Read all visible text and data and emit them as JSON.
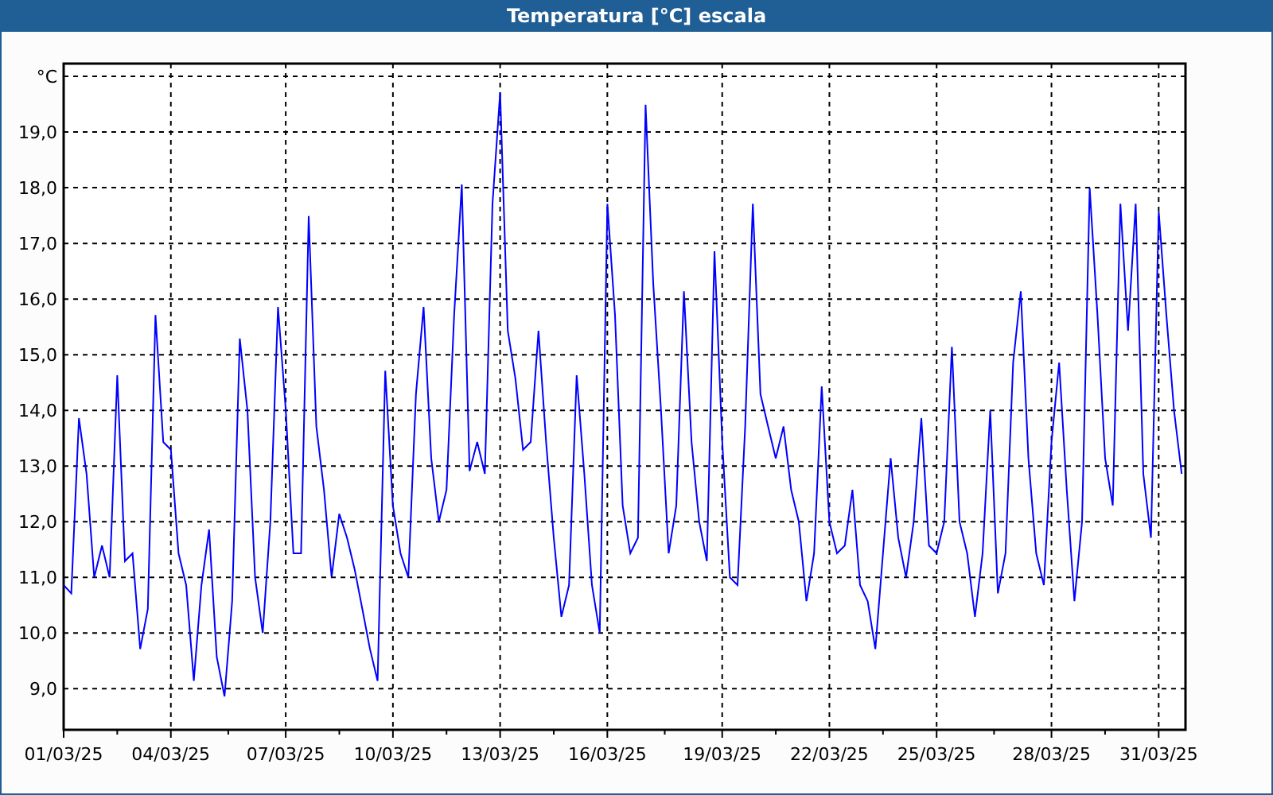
{
  "window": {
    "title": "Temperatura [°C] escala"
  },
  "chart": {
    "chart_data": {
      "type": "line",
      "categories": [
        "01/03/25",
        null,
        null,
        null,
        null,
        null,
        null,
        null,
        null,
        null,
        null,
        null,
        null,
        null,
        "04/03/25",
        null,
        null,
        null,
        null,
        null,
        null,
        null,
        null,
        null,
        null,
        null,
        null,
        null,
        null,
        "07/03/25",
        null,
        null,
        null,
        null,
        null,
        null,
        null,
        null,
        null,
        null,
        null,
        null,
        null,
        "10/03/25",
        null,
        null,
        null,
        null,
        null,
        null,
        null,
        null,
        null,
        null,
        null,
        null,
        null,
        "13/03/25",
        null,
        null,
        null,
        null,
        null,
        null,
        null,
        null,
        null,
        null,
        null,
        null,
        null,
        "16/03/25",
        null,
        null,
        null,
        null,
        null,
        null,
        null,
        null,
        null,
        null,
        null,
        null,
        null,
        null,
        "19/03/25",
        null,
        null,
        null,
        null,
        null,
        null,
        null,
        null,
        null,
        null,
        null,
        null,
        null,
        "22/03/25",
        null,
        null,
        null,
        null,
        null,
        null,
        null,
        null,
        null,
        null,
        null,
        null,
        null,
        "25/03/25",
        null,
        null,
        null,
        null,
        null,
        null,
        null,
        null,
        null,
        null,
        null,
        null,
        null,
        null,
        "28/03/25",
        null,
        null,
        null,
        null,
        null,
        null,
        null,
        null,
        null,
        null,
        null,
        null,
        null,
        "31/03/25",
        null,
        null,
        null
      ],
      "series": [
        {
          "color": "#0000ff",
          "values": [
            10.86,
            10.71,
            13.86,
            12.86,
            11.0,
            11.57,
            11.0,
            14.63,
            11.29,
            11.43,
            9.71,
            10.43,
            15.71,
            13.43,
            13.29,
            11.43,
            10.86,
            9.14,
            10.86,
            11.86,
            9.57,
            8.86,
            10.57,
            15.29,
            14.0,
            11.0,
            10.0,
            12.0,
            15.86,
            14.0,
            11.43,
            11.43,
            17.49,
            13.71,
            12.57,
            11.0,
            12.14,
            11.71,
            11.14,
            10.43,
            9.71,
            9.14,
            14.71,
            12.29,
            11.43,
            11.0,
            14.29,
            15.86,
            13.14,
            12.0,
            12.57,
            15.71,
            18.06,
            12.91,
            13.43,
            12.86,
            17.71,
            19.71,
            15.43,
            14.57,
            13.29,
            13.43,
            15.43,
            13.43,
            11.71,
            10.29,
            10.86,
            14.63,
            12.86,
            10.86,
            10.0,
            17.71,
            15.71,
            12.29,
            11.43,
            11.71,
            19.49,
            16.29,
            14.0,
            11.43,
            12.29,
            16.14,
            13.43,
            12.0,
            11.29,
            16.86,
            13.43,
            11.0,
            10.86,
            13.71,
            17.71,
            14.29,
            13.71,
            13.14,
            13.71,
            12.57,
            12.0,
            10.57,
            11.43,
            14.43,
            12.0,
            11.43,
            11.57,
            12.57,
            10.86,
            10.57,
            9.71,
            11.43,
            13.14,
            11.71,
            11.0,
            12.0,
            13.86,
            11.57,
            11.43,
            12.0,
            15.14,
            12.0,
            11.43,
            10.29,
            11.43,
            14.0,
            10.71,
            11.43,
            14.86,
            16.14,
            13.14,
            11.43,
            10.86,
            13.43,
            14.86,
            12.57,
            10.57,
            12.0,
            18.0,
            15.71,
            13.14,
            12.29,
            17.71,
            15.43,
            17.71,
            12.86,
            11.71,
            17.57,
            15.71,
            14.0,
            12.86
          ]
        }
      ],
      "grid": true,
      "ylim": [
        8.26,
        20.23
      ],
      "yticks": [
        {
          "value": 9,
          "label": "9,0"
        },
        {
          "value": 10,
          "label": "10,0"
        },
        {
          "value": 11,
          "label": "11,0"
        },
        {
          "value": 12,
          "label": "12,0"
        },
        {
          "value": 13,
          "label": "13,0"
        },
        {
          "value": 14,
          "label": "14,0"
        },
        {
          "value": 15,
          "label": "15,0"
        },
        {
          "value": 16,
          "label": "16,0"
        },
        {
          "value": 17,
          "label": "17,0"
        },
        {
          "value": 18,
          "label": "18,0"
        },
        {
          "value": 19,
          "label": "19,0"
        },
        {
          "value": 20,
          "label": "°C"
        }
      ]
    }
  }
}
